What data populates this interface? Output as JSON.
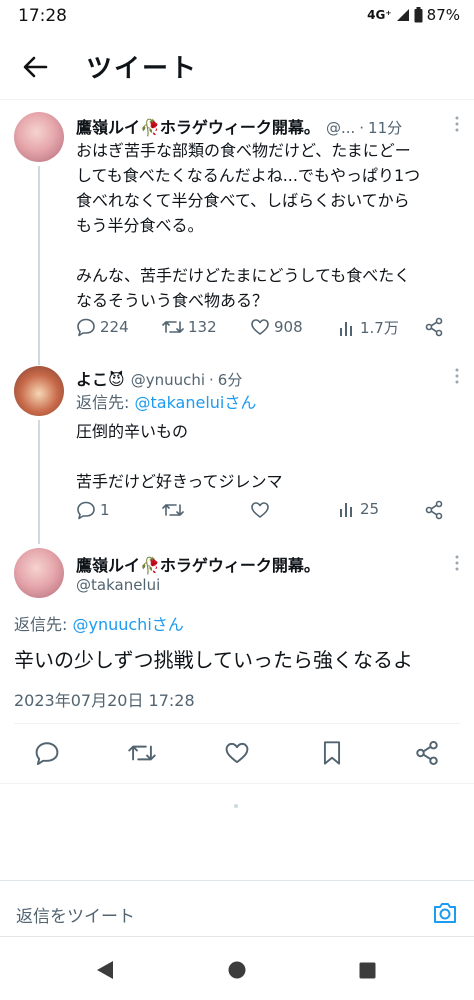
{
  "status": {
    "time": "17:28",
    "network": "4G⁺",
    "battery": "87%"
  },
  "header": {
    "title": "ツイート"
  },
  "tweets": [
    {
      "name": "鷹嶺ルイ🥀ホラゲウィーク開幕。",
      "handle": "@...",
      "time": "11分",
      "paragraph1": [
        "おはぎ苦手な部類の食べ物だけど、たまにどー",
        "しても食べたくなるんだよね...でもやっぱり1つ",
        "食べれなくて半分食べて、しばらくおいてから",
        "もう半分食べる。"
      ],
      "paragraph2": [
        "みんな、苦手だけどたまにどうしても食べたく",
        "なるそういう食べ物ある？"
      ],
      "replies": "224",
      "retweets": "132",
      "likes": "908",
      "views": "1.7万"
    },
    {
      "name": "よこ😈",
      "handle": "@ynuuchi",
      "time": "6分",
      "reply_to_label": "返信先: ",
      "reply_to_handle": "@takaneluiさん",
      "line1": "圧倒的辛いもの",
      "line2": "苦手だけど好きってジレンマ",
      "replies": "1",
      "retweets": "",
      "likes": "",
      "views": "25"
    }
  ],
  "main_tweet": {
    "name": "鷹嶺ルイ🥀ホラゲウィーク開幕。",
    "handle": "@takanelui",
    "reply_to_label": "返信先: ",
    "reply_to_handle": "@ynuuchiさん",
    "text": "辛いの少しずつ挑戦していったら強くなるよ",
    "timestamp": "2023年07月20日 17:28"
  },
  "composer": {
    "placeholder": "返信をツイート"
  },
  "icons": {
    "reply": "reply-icon",
    "retweet": "retweet-icon",
    "like": "heart-icon",
    "views": "views-icon",
    "share": "share-icon",
    "bookmark": "bookmark-icon",
    "camera": "camera-icon"
  },
  "colors": {
    "accent": "#1d9bf0",
    "text": "#0f1419",
    "secondary": "#536471"
  }
}
